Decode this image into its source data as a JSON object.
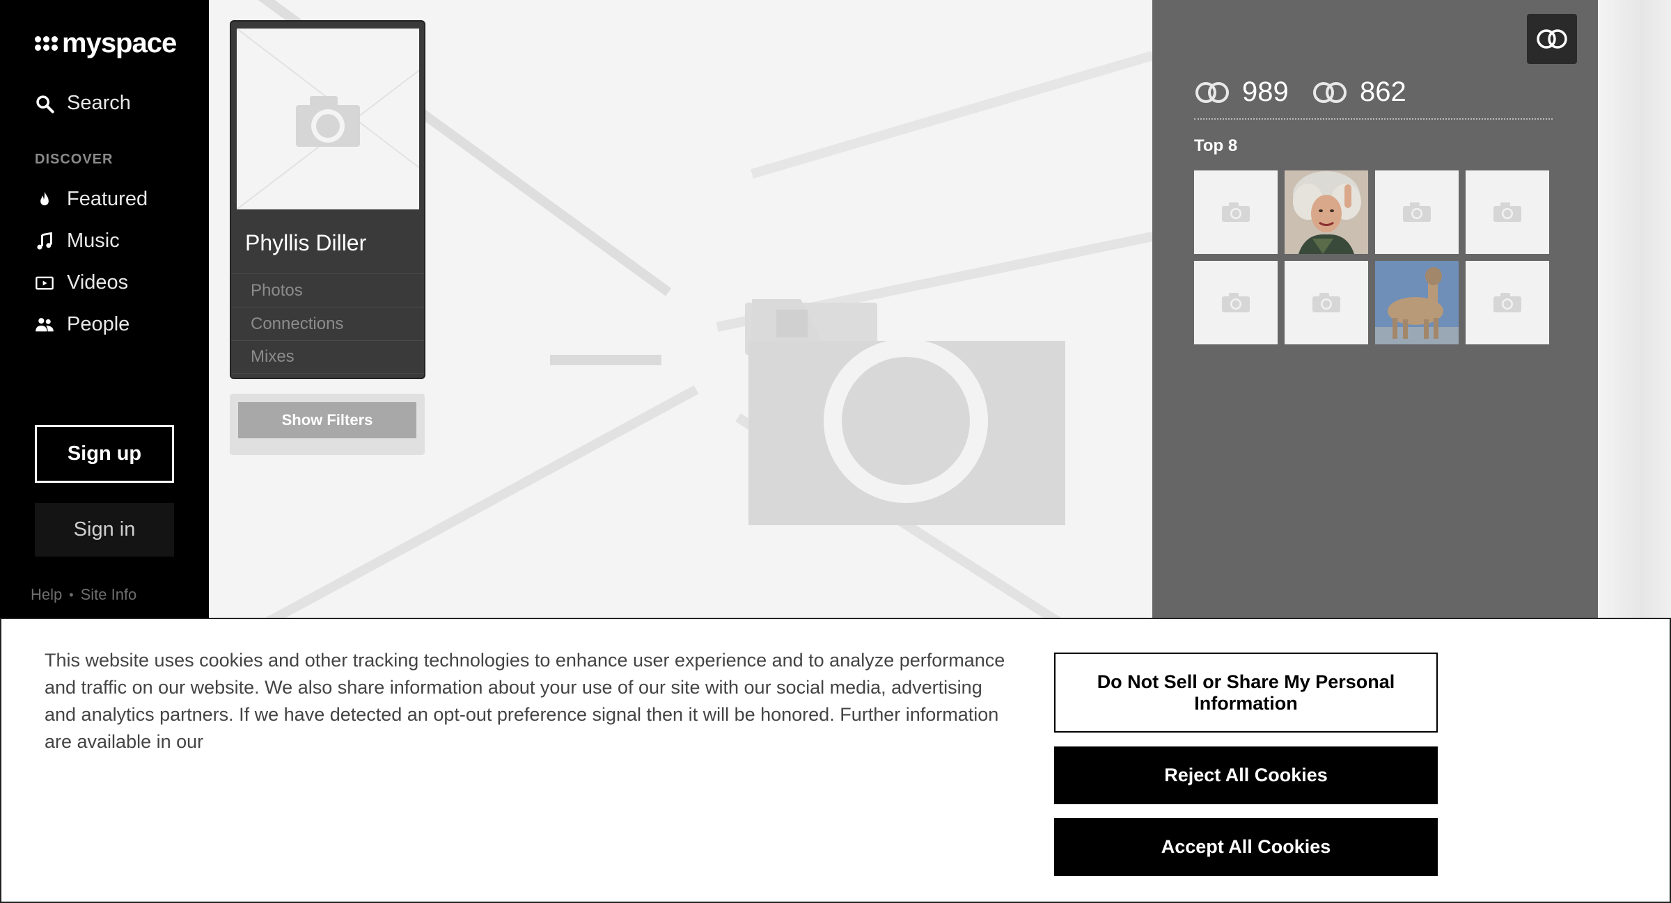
{
  "sidebar": {
    "logo_text": "myspace",
    "search_label": "Search",
    "discover_heading": "DISCOVER",
    "nav": [
      {
        "label": "Featured",
        "icon": "flame-icon"
      },
      {
        "label": "Music",
        "icon": "music-note-icon"
      },
      {
        "label": "Videos",
        "icon": "video-icon"
      },
      {
        "label": "People",
        "icon": "people-icon"
      }
    ],
    "signup_label": "Sign up",
    "signin_label": "Sign in",
    "footer": {
      "help": "Help",
      "separator": "•",
      "site_info": "Site Info"
    }
  },
  "profile": {
    "name": "Phyllis Diller",
    "links": [
      "Photos",
      "Connections",
      "Mixes"
    ],
    "photo_icon": "camera-placeholder-icon"
  },
  "filters": {
    "show_filters_label": "Show Filters"
  },
  "stats": {
    "connections_in": "989",
    "connections_out": "862",
    "stat_icon": "connect-rings-icon"
  },
  "top8": {
    "label": "Top 8",
    "items": [
      {
        "type": "placeholder"
      },
      {
        "type": "photo-portrait"
      },
      {
        "type": "placeholder"
      },
      {
        "type": "placeholder"
      },
      {
        "type": "placeholder"
      },
      {
        "type": "placeholder"
      },
      {
        "type": "photo-llama"
      },
      {
        "type": "placeholder"
      }
    ]
  },
  "cookie_banner": {
    "text": "This website uses cookies and other tracking technologies to enhance user experience and to analyze performance and traffic on our website. We also share information about your use of our site with our social media, advertising and analytics partners. If we have detected an opt-out preference signal then it will be honored. Further information are available in our",
    "do_not_sell_label": "Do Not Sell or Share My Personal Information",
    "reject_label": "Reject All Cookies",
    "accept_label": "Accept All Cookies"
  },
  "colors": {
    "sidebar_bg": "#000000",
    "right_panel_bg": "#666666",
    "card_bg": "#3a3a3a",
    "button_black": "#000000"
  }
}
